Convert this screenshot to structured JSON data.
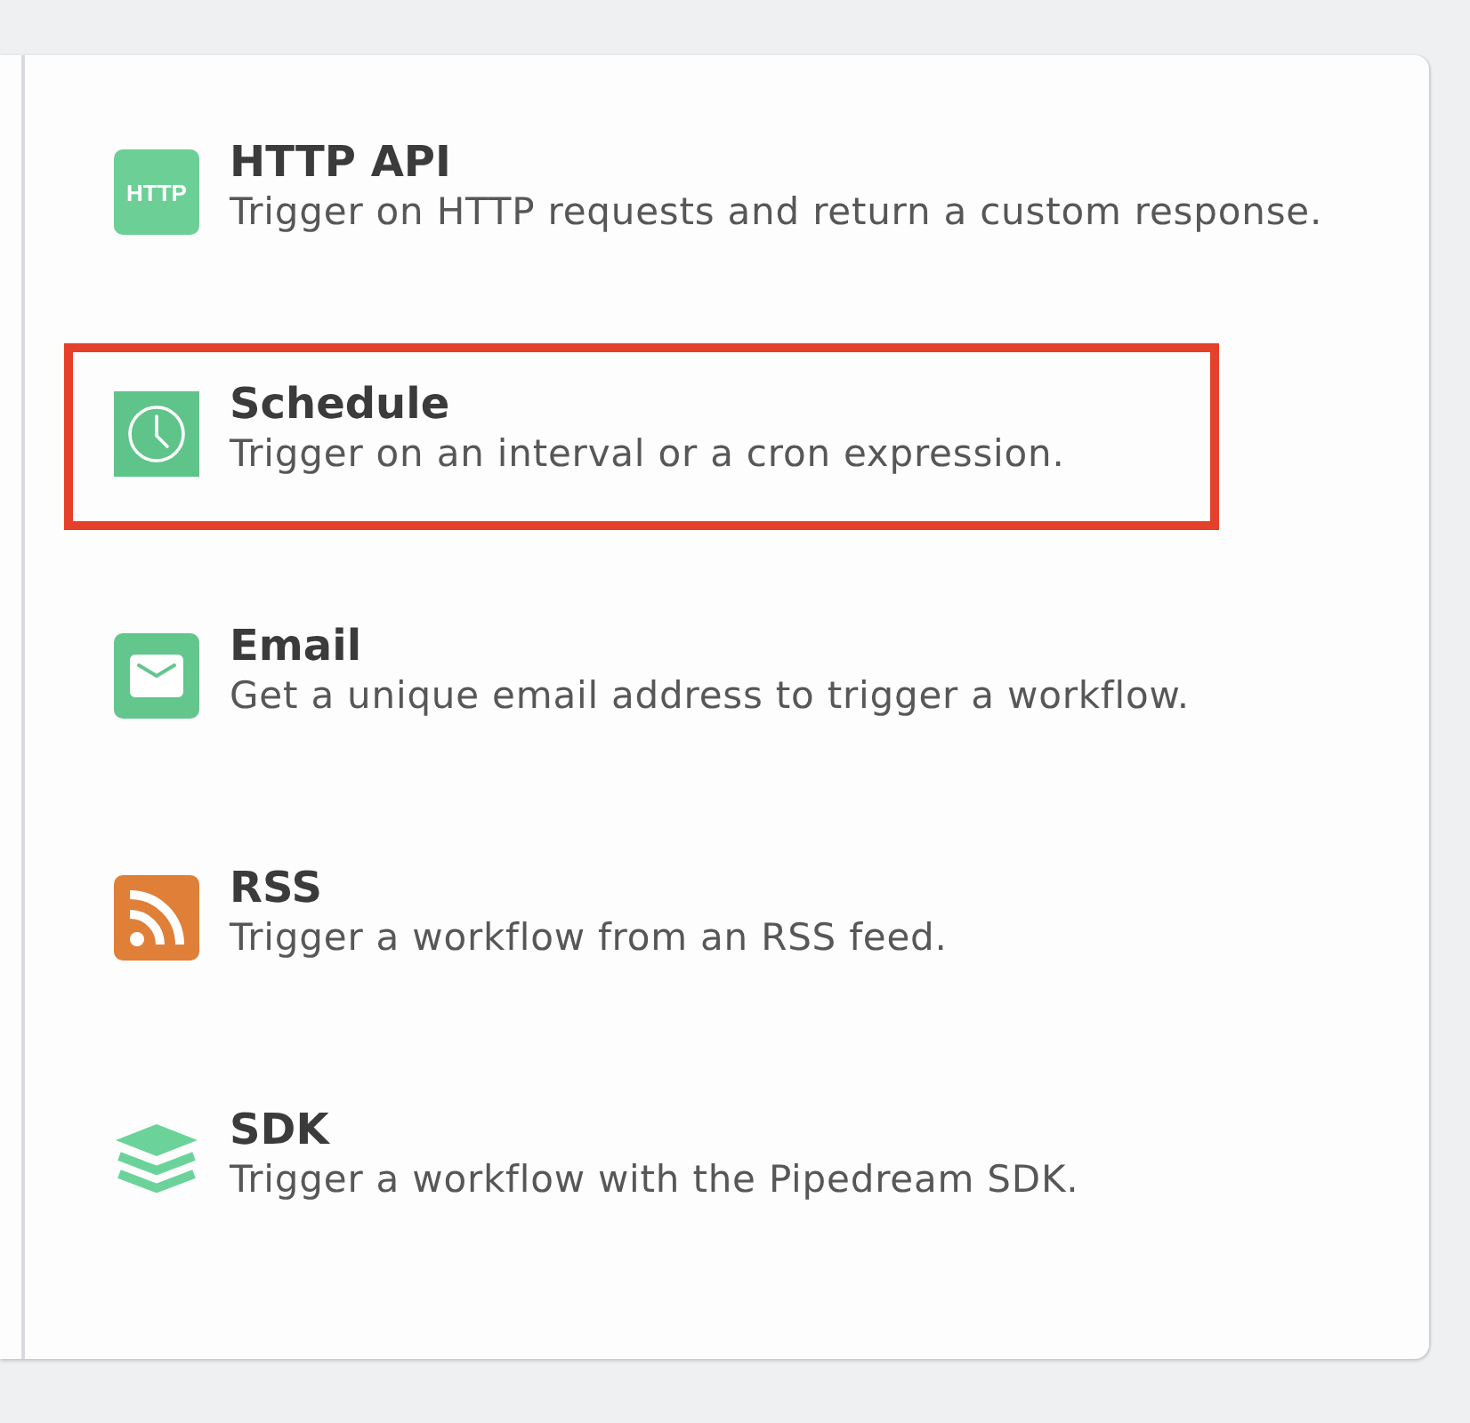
{
  "triggers": [
    {
      "kind": "http",
      "badge": "HTTP",
      "title": "HTTP API",
      "description": "Trigger on HTTP requests and return a custom response.",
      "highlighted": false
    },
    {
      "kind": "clock",
      "title": "Schedule",
      "description": "Trigger on an interval or a cron expression.",
      "highlighted": true
    },
    {
      "kind": "mail",
      "title": "Email",
      "description": "Get a unique email address to trigger a workflow.",
      "highlighted": false
    },
    {
      "kind": "rss",
      "title": "RSS",
      "description": "Trigger a workflow from an RSS feed.",
      "highlighted": false
    },
    {
      "kind": "layers",
      "title": "SDK",
      "description": "Trigger a workflow with the Pipedream SDK.",
      "highlighted": false
    }
  ]
}
